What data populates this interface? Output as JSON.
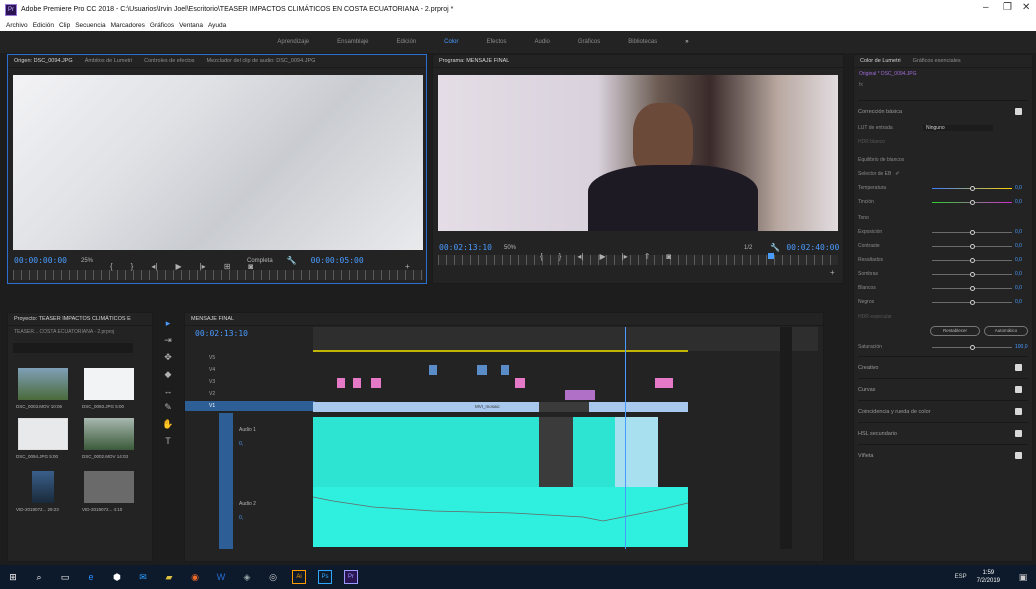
{
  "window": {
    "title": "Adobe Premiere Pro CC 2018 - C:\\Usuarios\\Irvin Joel\\Escritorio\\TEASER IMPACTOS CLIMÁTICOS EN COSTA ECUATORIANA - 2.prproj *",
    "app_icon": "Pr"
  },
  "menu": [
    "Archivo",
    "Edición",
    "Clip",
    "Secuencia",
    "Marcadores",
    "Gráficos",
    "Ventana",
    "Ayuda"
  ],
  "workspaces": [
    "Aprendizaje",
    "Ensamblaje",
    "Edición",
    "Color",
    "Efectos",
    "Audio",
    "Gráficos",
    "Bibliotecas"
  ],
  "workspace_more": "»",
  "source": {
    "tabs": [
      "Origen: DSC_0094.JPG",
      "Ámbitos de Lumetri",
      "Controles de efectos",
      "Mezclador del clip de audio: DSC_0094.JPG"
    ],
    "timecode": "00:00:00:00",
    "zoom": "25%",
    "resolution": "Completa",
    "duration": "00:00:05:00"
  },
  "program": {
    "tab": "Programa: MENSAJE FINAL",
    "timecode": "00:02:13:10",
    "zoom": "50%",
    "resolution": "1/2",
    "duration": "00:02:40:00"
  },
  "project": {
    "tab": "Proyecto: TEASER IMPACTOS CLIMÁTICOS E",
    "path": "TEASER... COSTA ECUATORIANA - 2.prproj",
    "thumbs": [
      {
        "name": "DSC_0003.MOV",
        "dur": "10:06"
      },
      {
        "name": "DSC_0093.JPG",
        "dur": "5:00"
      },
      {
        "name": "DSC_0094.JPG",
        "dur": "5:00"
      },
      {
        "name": "DSC_0002.MOV",
        "dur": "14:03"
      },
      {
        "name": "VID-2019072...",
        "dur": "29:23"
      },
      {
        "name": "VID-2019072...",
        "dur": "4:10"
      }
    ]
  },
  "timeline": {
    "tab": "MENSAJE FINAL",
    "timecode": "00:02:13:10",
    "tracks": [
      "V5",
      "V4",
      "V3",
      "V2",
      "V1"
    ],
    "a1": "Audio 1",
    "a2": "Audio 2",
    "a1_val": "0,",
    "a2_val": "0,",
    "clip_label": "MVI_mosaic"
  },
  "lumetri": {
    "tabs": [
      "Color de Lumetri",
      "Gráficos esenciales"
    ],
    "source": "Original * DSC_0094.JPG",
    "fx": "fx",
    "basic": "Corrección básica",
    "lut_label": "LUT de entrada",
    "lut_value": "Ninguno",
    "hdr": "HDR blanco",
    "wb": "Equilibrio de blancos",
    "wb_selector": "Selector de EB",
    "temp": "Temperatura",
    "tint": "Tinción",
    "tone": "Tono",
    "rows": [
      "Exposición",
      "Contraste",
      "Resaltados",
      "Sombras",
      "Blancos",
      "Negros"
    ],
    "hdr_spec": "HDR especular",
    "reset": "Restablecer",
    "auto": "Automático",
    "sat": "Saturación",
    "sat_val": "100,0",
    "zero": "0,0",
    "sections": [
      "Creativo",
      "Curvas",
      "Coincidencia y rueda de color",
      "HSL secundario",
      "Viñeta"
    ]
  },
  "taskbar": {
    "ime": "ESP",
    "time": "1:59",
    "date": "7/2/2019"
  }
}
